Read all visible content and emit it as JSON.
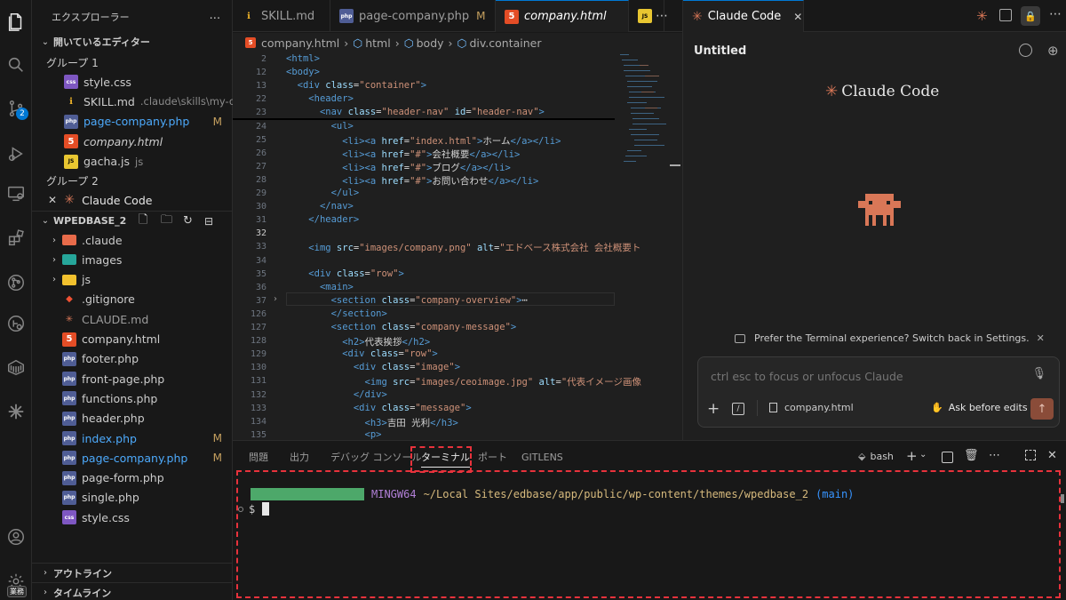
{
  "activity": {
    "settings_badge": "2",
    "bottom_badge": "業務"
  },
  "sidebar": {
    "header": "エクスプローラー",
    "open_editors": "開いているエディター",
    "group1": "グループ 1",
    "group1_items": [
      {
        "label": "style.css",
        "desc": "",
        "status": "",
        "icon": "css"
      },
      {
        "label": "SKILL.md",
        "desc": ".claude\\skills\\my-o...",
        "status": "",
        "icon": "md"
      },
      {
        "label": "page-company.php",
        "desc": "",
        "status": "M",
        "icon": "php"
      },
      {
        "label": "company.html",
        "desc": "",
        "status": "",
        "icon": "html"
      },
      {
        "label": "gacha.js",
        "desc": "js",
        "status": "",
        "icon": "js"
      }
    ],
    "group2": "グループ 2",
    "group2_items": [
      {
        "label": "Claude Code",
        "close": "✕"
      }
    ],
    "project": "WPEDBASE_2",
    "tree": [
      {
        "label": ".claude",
        "type": "folder",
        "icon": "folder-claude"
      },
      {
        "label": "images",
        "type": "folder",
        "icon": "folder-images"
      },
      {
        "label": "js",
        "type": "folder",
        "icon": "folder-js"
      },
      {
        "label": ".gitignore",
        "type": "file",
        "icon": "git"
      },
      {
        "label": "CLAUDE.md",
        "type": "file",
        "icon": "claude"
      },
      {
        "label": "company.html",
        "type": "file",
        "icon": "html"
      },
      {
        "label": "footer.php",
        "type": "file",
        "icon": "php"
      },
      {
        "label": "front-page.php",
        "type": "file",
        "icon": "php"
      },
      {
        "label": "functions.php",
        "type": "file",
        "icon": "php"
      },
      {
        "label": "header.php",
        "type": "file",
        "icon": "php"
      },
      {
        "label": "index.php",
        "type": "file",
        "icon": "php",
        "status": "M"
      },
      {
        "label": "page-company.php",
        "type": "file",
        "icon": "php",
        "status": "M"
      },
      {
        "label": "page-form.php",
        "type": "file",
        "icon": "php"
      },
      {
        "label": "single.php",
        "type": "file",
        "icon": "php"
      },
      {
        "label": "style.css",
        "type": "file",
        "icon": "css"
      }
    ],
    "outline": "アウトライン",
    "timeline": "タイムライン"
  },
  "tabs": [
    {
      "label": "SKILL.md",
      "icon": "md",
      "status": "",
      "active": false
    },
    {
      "label": "page-company.php",
      "icon": "php",
      "status": "M",
      "active": false
    },
    {
      "label": "company.html",
      "icon": "html",
      "status": "",
      "active": true
    },
    {
      "label": "",
      "icon": "js",
      "status": "",
      "active": false
    }
  ],
  "breadcrumb": [
    "company.html",
    "html",
    "body",
    "div.container"
  ],
  "editor": {
    "lines": [
      {
        "n": "2",
        "code": "<html>"
      },
      {
        "n": "12",
        "code": "<body>"
      },
      {
        "n": "13",
        "code": "  <div class=\"container\">"
      },
      {
        "n": "22",
        "code": "    <header>"
      },
      {
        "n": "23",
        "code": "      <nav class=\"header-nav\" id=\"header-nav\">"
      },
      {
        "n": "24",
        "code": "        <ul>"
      },
      {
        "n": "25",
        "code": "          <li><a href=\"index.html\">ホーム</a></li>"
      },
      {
        "n": "26",
        "code": "          <li><a href=\"#\">会社概要</a></li>"
      },
      {
        "n": "27",
        "code": "          <li><a href=\"#\">ブログ</a></li>"
      },
      {
        "n": "28",
        "code": "          <li><a href=\"#\">お問い合わせ</a></li>"
      },
      {
        "n": "29",
        "code": "        </ul>"
      },
      {
        "n": "30",
        "code": "      </nav>"
      },
      {
        "n": "31",
        "code": "    </header>"
      },
      {
        "n": "32",
        "code": ""
      },
      {
        "n": "33",
        "code": "    <img src=\"images/company.png\" alt=\"エドベース株式会社 会社概要ト"
      },
      {
        "n": "34",
        "code": ""
      },
      {
        "n": "35",
        "code": "    <div class=\"row\">"
      },
      {
        "n": "36",
        "code": "      <main>"
      },
      {
        "n": "37",
        "code": "        <section class=\"company-overview\">⋯"
      },
      {
        "n": "126",
        "code": "        </section>"
      },
      {
        "n": "127",
        "code": "        <section class=\"company-message\">"
      },
      {
        "n": "128",
        "code": "          <h2>代表挨拶</h2>"
      },
      {
        "n": "129",
        "code": "          <div class=\"row\">"
      },
      {
        "n": "130",
        "code": "            <div class=\"image\">"
      },
      {
        "n": "131",
        "code": "              <img src=\"images/ceoimage.jpg\" alt=\"代表イメージ画像"
      },
      {
        "n": "132",
        "code": "            </div>"
      },
      {
        "n": "133",
        "code": "            <div class=\"message\">"
      },
      {
        "n": "134",
        "code": "              <h3>吉田 光利</h3>"
      },
      {
        "n": "135",
        "code": "              <p>"
      }
    ]
  },
  "claude": {
    "tab_label": "Claude Code",
    "title": "Untitled",
    "logo_text": "Claude Code",
    "notice": "Prefer the Terminal experience? Switch back in Settings.",
    "input_placeholder": "ctrl esc to focus or unfocus Claude",
    "file_chip": "company.html",
    "mode": "Ask before edits"
  },
  "panel": {
    "tabs": [
      "問題",
      "出力",
      "デバッグ コンソール",
      "ターミナル",
      "ポート",
      "GITLENS"
    ],
    "active_tab": "ターミナル",
    "shell": "bash",
    "prompt_env": "MINGW64",
    "prompt_path": "~/Local Sites/edbase/app/public/wp-content/themes/wpedbase_2",
    "prompt_branch": "(main)",
    "prompt_symbol": "$"
  },
  "colors": {
    "accent": "#0078d4",
    "claude": "#d97757",
    "annotation": "#e8323c",
    "modified": "#c5a05f"
  }
}
